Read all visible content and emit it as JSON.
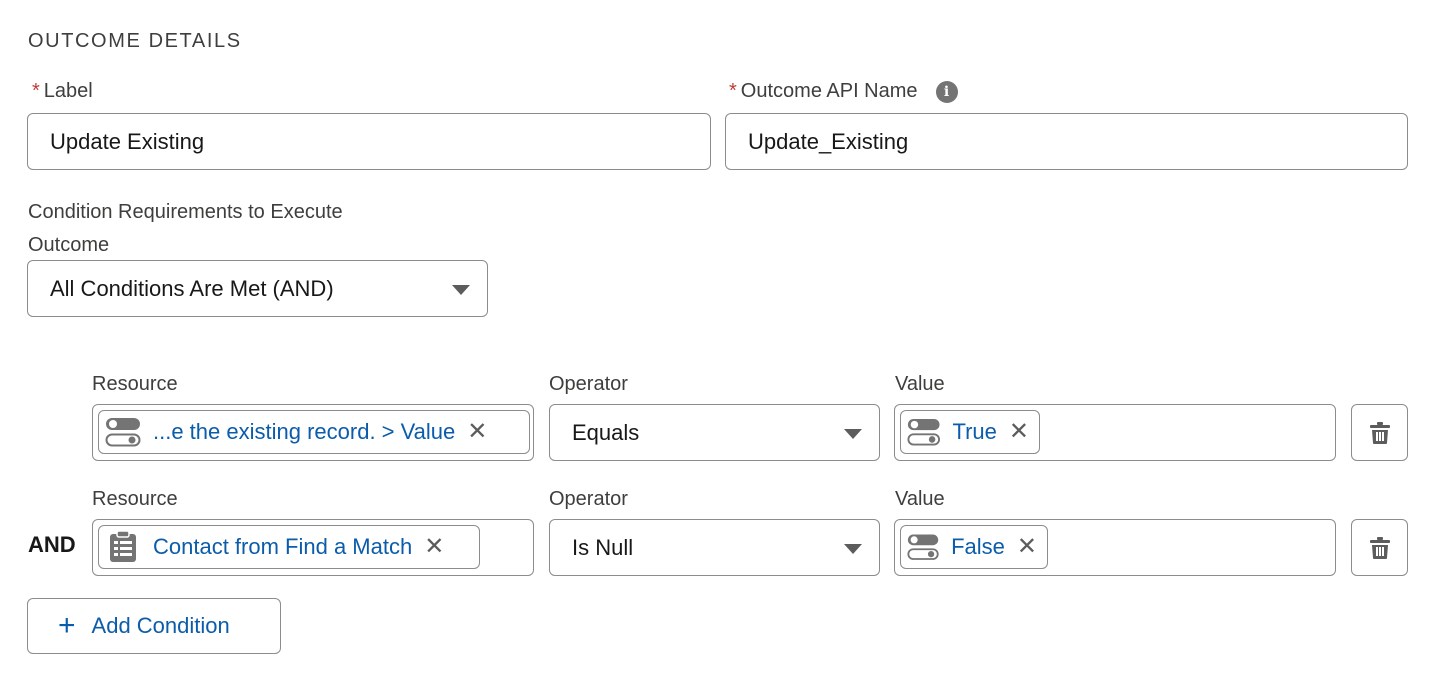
{
  "section": {
    "title": "OUTCOME DETAILS"
  },
  "label_field": {
    "label": "Label",
    "required_marker": "*",
    "value": "Update Existing"
  },
  "api_name_field": {
    "label": "Outcome API Name",
    "required_marker": "*",
    "value": "Update_Existing",
    "info_icon": "info-icon"
  },
  "condition_requirements": {
    "label_line1": "Condition Requirements to Execute",
    "label_line2": "Outcome",
    "selected": "All Conditions Are Met (AND)"
  },
  "conditions": [
    {
      "logic": "",
      "resource_label": "Resource",
      "resource_value": "...e the existing record. > Value",
      "resource_icon": "toggle-icon",
      "operator_label": "Operator",
      "operator_value": "Equals",
      "value_label": "Value",
      "value_value": "True",
      "value_icon": "toggle-icon"
    },
    {
      "logic": "AND",
      "resource_label": "Resource",
      "resource_value": "Contact from Find a Match",
      "resource_icon": "record-icon",
      "operator_label": "Operator",
      "operator_value": "Is Null",
      "value_label": "Value",
      "value_value": "False",
      "value_icon": "toggle-icon"
    }
  ],
  "add_condition": {
    "label": "Add Condition"
  },
  "colors": {
    "link": "#0b5cab",
    "required": "#c23934",
    "border": "#8c8c8c"
  }
}
